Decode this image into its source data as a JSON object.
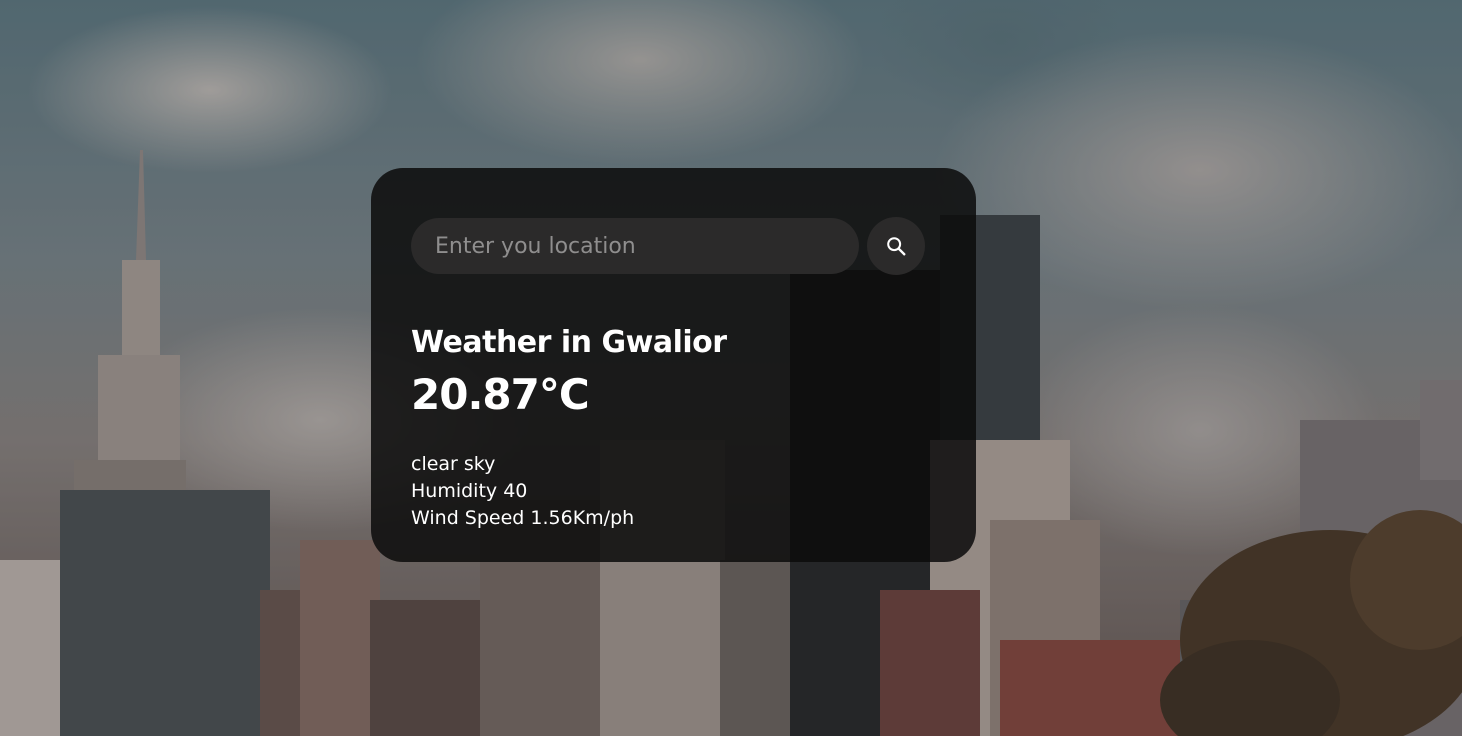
{
  "search": {
    "value": "",
    "placeholder": "Enter you location",
    "button_icon": "search-icon"
  },
  "weather": {
    "city_title": "Weather in Gwalior",
    "temperature": "20.87°C",
    "description": "clear sky",
    "humidity": "Humidity 40",
    "wind": "Wind Speed 1.56Km/ph"
  },
  "colors": {
    "card_background": "#0c0c0c",
    "input_background": "#2b2a2a",
    "text": "#ffffff",
    "placeholder": "#8f8e8e"
  }
}
